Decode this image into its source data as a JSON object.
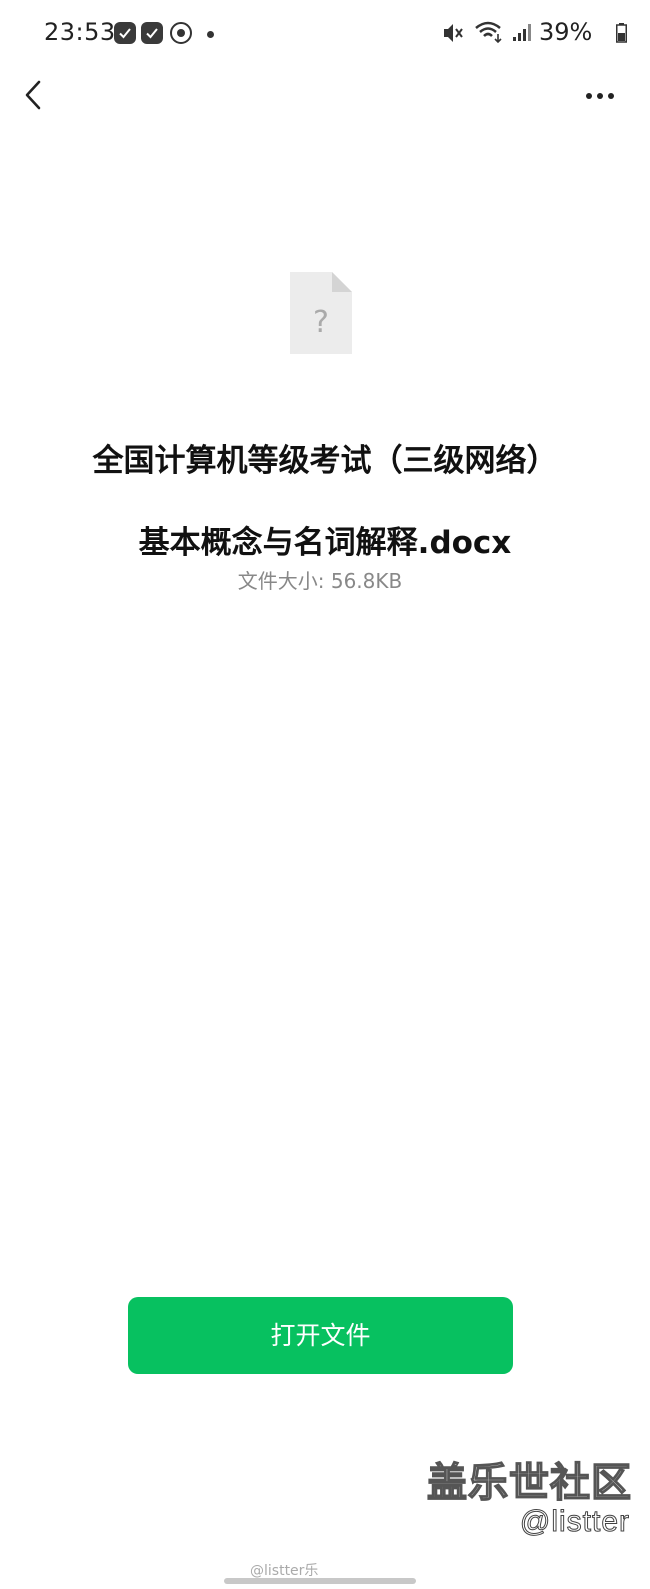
{
  "status_bar": {
    "time": "23:53",
    "battery": "39%"
  },
  "file": {
    "title_line1": "全国计算机等级考试（三级网络）",
    "title_line2": "基本概念与名词解释.docx",
    "size_label": "文件大小: 56.8KB",
    "icon_glyph": "?"
  },
  "actions": {
    "open_label": "打开文件"
  },
  "watermark": {
    "brand": "盖乐世社区",
    "handle": "@listter",
    "weibo": "@listter乐"
  },
  "colors": {
    "accent": "#07c160",
    "title": "#111111",
    "secondary": "#888888"
  }
}
